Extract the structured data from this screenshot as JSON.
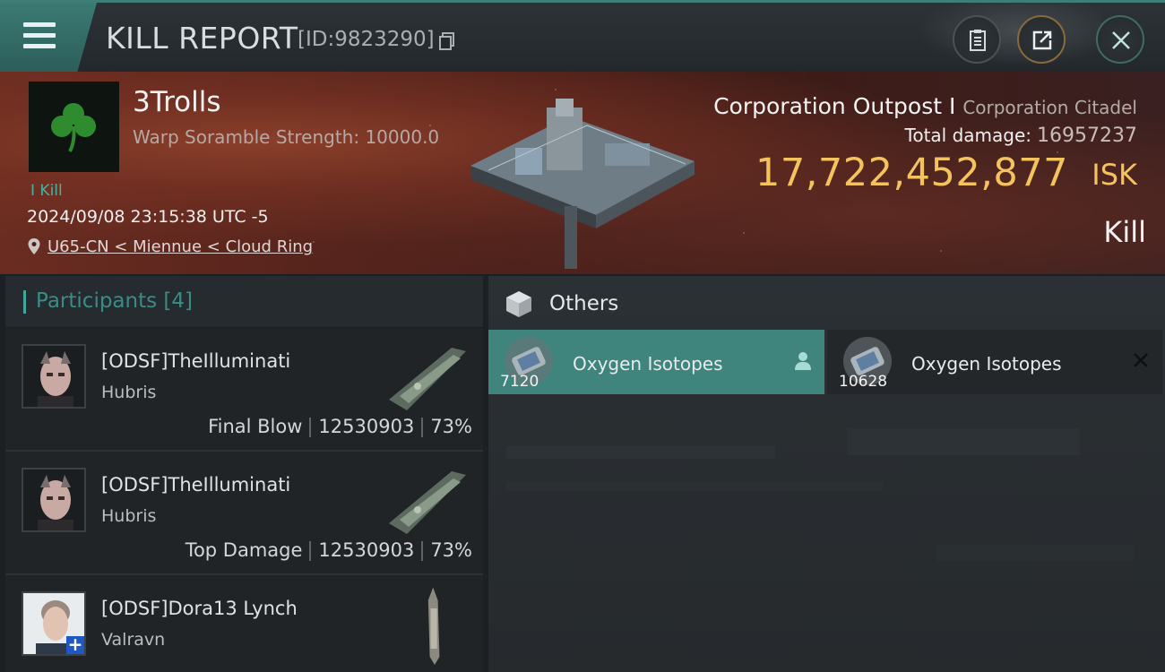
{
  "header": {
    "title": "KILL REPORT",
    "report_id": "[ID:9823290]",
    "icons": [
      "menu-icon",
      "copy-icon",
      "clipboard-icon",
      "share-icon",
      "close-icon"
    ]
  },
  "victim": {
    "name": "3Trolls",
    "subtitle": "Warp Soramble Strength: 10000.0",
    "kill_tag": "I Kill",
    "timestamp": "2024/09/08 23:15:38 UTC -5",
    "location": "U65-CN < Miennue < Cloud Ring",
    "structure_name": "Corporation Outpost I",
    "structure_class": "Corporation Citadel",
    "total_damage_label": "Total damage:",
    "total_damage": "16957237",
    "isk_value": "17,722,452,877",
    "isk_unit": "ISK",
    "result": "Kill",
    "logo_color": "#2e8b2e"
  },
  "participants": {
    "header": "Participants",
    "count": "[4]",
    "rows": [
      {
        "name": "[ODSF]TheIlluminati",
        "ship": "Hubris",
        "role": "Final Blow",
        "damage": "12530903",
        "percent": "73%"
      },
      {
        "name": "[ODSF]TheIlluminati",
        "ship": "Hubris",
        "role": "Top Damage",
        "damage": "12530903",
        "percent": "73%"
      },
      {
        "name": "[ODSF]Dora13 Lynch",
        "ship": "Valravn",
        "role": "",
        "damage": "",
        "percent": ""
      }
    ]
  },
  "others": {
    "title": "Others",
    "items": [
      {
        "name": "Oxygen Isotopes",
        "quantity": "7120",
        "selected": true
      },
      {
        "name": "Oxygen Isotopes",
        "quantity": "10628",
        "selected": false
      }
    ]
  },
  "colors": {
    "accent": "#3f857d",
    "isk": "#f4c35e",
    "kill_tag": "#44b3a5"
  }
}
